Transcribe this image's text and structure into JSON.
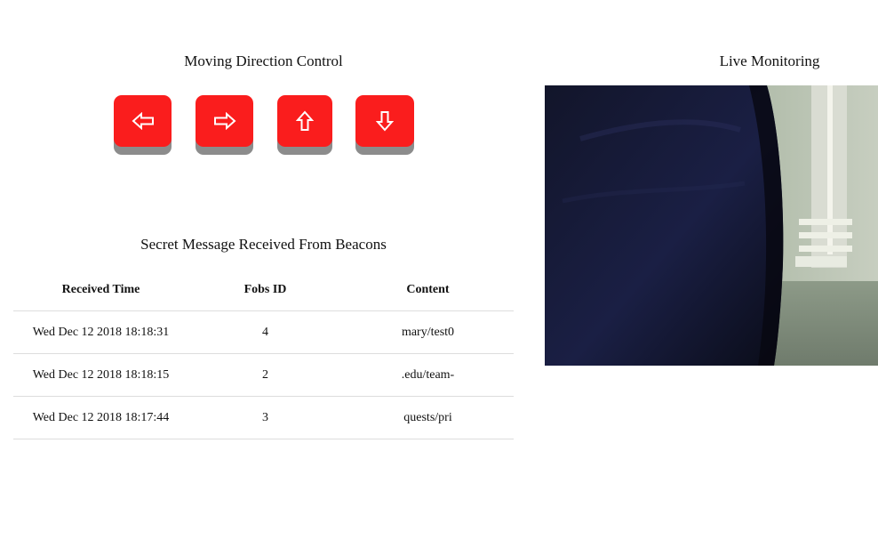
{
  "control": {
    "title": "Moving Direction Control",
    "buttons": [
      {
        "direction": "left",
        "icon": "arrow-left-icon"
      },
      {
        "direction": "right",
        "icon": "arrow-right-icon"
      },
      {
        "direction": "up",
        "icon": "arrow-up-icon"
      },
      {
        "direction": "down",
        "icon": "arrow-down-icon"
      }
    ],
    "button_color": "#fa1d1d"
  },
  "monitor": {
    "title": "Live Monitoring"
  },
  "beacons": {
    "title": "Secret Message Received From Beacons",
    "columns": [
      "Received Time",
      "Fobs ID",
      "Content"
    ],
    "rows": [
      [
        "Wed Dec 12 2018 18:18:31",
        "4",
        "mary/test0"
      ],
      [
        "Wed Dec 12 2018 18:18:15",
        "2",
        ".edu/team-"
      ],
      [
        "Wed Dec 12 2018 18:17:44",
        "3",
        "quests/pri"
      ]
    ]
  }
}
